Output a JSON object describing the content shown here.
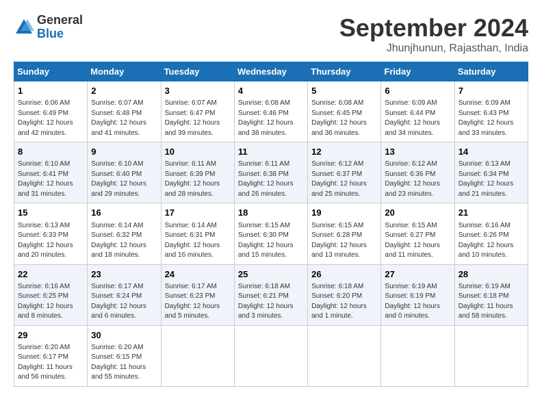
{
  "header": {
    "logo_general": "General",
    "logo_blue": "Blue",
    "month_title": "September 2024",
    "location": "Jhunjhunun, Rajasthan, India"
  },
  "weekdays": [
    "Sunday",
    "Monday",
    "Tuesday",
    "Wednesday",
    "Thursday",
    "Friday",
    "Saturday"
  ],
  "weeks": [
    [
      {
        "day": 1,
        "sunrise": "6:06 AM",
        "sunset": "6:49 PM",
        "daylight": "12 hours and 42 minutes."
      },
      {
        "day": 2,
        "sunrise": "6:07 AM",
        "sunset": "6:48 PM",
        "daylight": "12 hours and 41 minutes."
      },
      {
        "day": 3,
        "sunrise": "6:07 AM",
        "sunset": "6:47 PM",
        "daylight": "12 hours and 39 minutes."
      },
      {
        "day": 4,
        "sunrise": "6:08 AM",
        "sunset": "6:46 PM",
        "daylight": "12 hours and 38 minutes."
      },
      {
        "day": 5,
        "sunrise": "6:08 AM",
        "sunset": "6:45 PM",
        "daylight": "12 hours and 36 minutes."
      },
      {
        "day": 6,
        "sunrise": "6:09 AM",
        "sunset": "6:44 PM",
        "daylight": "12 hours and 34 minutes."
      },
      {
        "day": 7,
        "sunrise": "6:09 AM",
        "sunset": "6:43 PM",
        "daylight": "12 hours and 33 minutes."
      }
    ],
    [
      {
        "day": 8,
        "sunrise": "6:10 AM",
        "sunset": "6:41 PM",
        "daylight": "12 hours and 31 minutes."
      },
      {
        "day": 9,
        "sunrise": "6:10 AM",
        "sunset": "6:40 PM",
        "daylight": "12 hours and 29 minutes."
      },
      {
        "day": 10,
        "sunrise": "6:11 AM",
        "sunset": "6:39 PM",
        "daylight": "12 hours and 28 minutes."
      },
      {
        "day": 11,
        "sunrise": "6:11 AM",
        "sunset": "6:38 PM",
        "daylight": "12 hours and 26 minutes."
      },
      {
        "day": 12,
        "sunrise": "6:12 AM",
        "sunset": "6:37 PM",
        "daylight": "12 hours and 25 minutes."
      },
      {
        "day": 13,
        "sunrise": "6:12 AM",
        "sunset": "6:36 PM",
        "daylight": "12 hours and 23 minutes."
      },
      {
        "day": 14,
        "sunrise": "6:13 AM",
        "sunset": "6:34 PM",
        "daylight": "12 hours and 21 minutes."
      }
    ],
    [
      {
        "day": 15,
        "sunrise": "6:13 AM",
        "sunset": "6:33 PM",
        "daylight": "12 hours and 20 minutes."
      },
      {
        "day": 16,
        "sunrise": "6:14 AM",
        "sunset": "6:32 PM",
        "daylight": "12 hours and 18 minutes."
      },
      {
        "day": 17,
        "sunrise": "6:14 AM",
        "sunset": "6:31 PM",
        "daylight": "12 hours and 16 minutes."
      },
      {
        "day": 18,
        "sunrise": "6:15 AM",
        "sunset": "6:30 PM",
        "daylight": "12 hours and 15 minutes."
      },
      {
        "day": 19,
        "sunrise": "6:15 AM",
        "sunset": "6:28 PM",
        "daylight": "12 hours and 13 minutes."
      },
      {
        "day": 20,
        "sunrise": "6:15 AM",
        "sunset": "6:27 PM",
        "daylight": "12 hours and 11 minutes."
      },
      {
        "day": 21,
        "sunrise": "6:16 AM",
        "sunset": "6:26 PM",
        "daylight": "12 hours and 10 minutes."
      }
    ],
    [
      {
        "day": 22,
        "sunrise": "6:16 AM",
        "sunset": "6:25 PM",
        "daylight": "12 hours and 8 minutes."
      },
      {
        "day": 23,
        "sunrise": "6:17 AM",
        "sunset": "6:24 PM",
        "daylight": "12 hours and 6 minutes."
      },
      {
        "day": 24,
        "sunrise": "6:17 AM",
        "sunset": "6:23 PM",
        "daylight": "12 hours and 5 minutes."
      },
      {
        "day": 25,
        "sunrise": "6:18 AM",
        "sunset": "6:21 PM",
        "daylight": "12 hours and 3 minutes."
      },
      {
        "day": 26,
        "sunrise": "6:18 AM",
        "sunset": "6:20 PM",
        "daylight": "12 hours and 1 minute."
      },
      {
        "day": 27,
        "sunrise": "6:19 AM",
        "sunset": "6:19 PM",
        "daylight": "12 hours and 0 minutes."
      },
      {
        "day": 28,
        "sunrise": "6:19 AM",
        "sunset": "6:18 PM",
        "daylight": "11 hours and 58 minutes."
      }
    ],
    [
      {
        "day": 29,
        "sunrise": "6:20 AM",
        "sunset": "6:17 PM",
        "daylight": "11 hours and 56 minutes."
      },
      {
        "day": 30,
        "sunrise": "6:20 AM",
        "sunset": "6:15 PM",
        "daylight": "11 hours and 55 minutes."
      },
      null,
      null,
      null,
      null,
      null
    ]
  ]
}
